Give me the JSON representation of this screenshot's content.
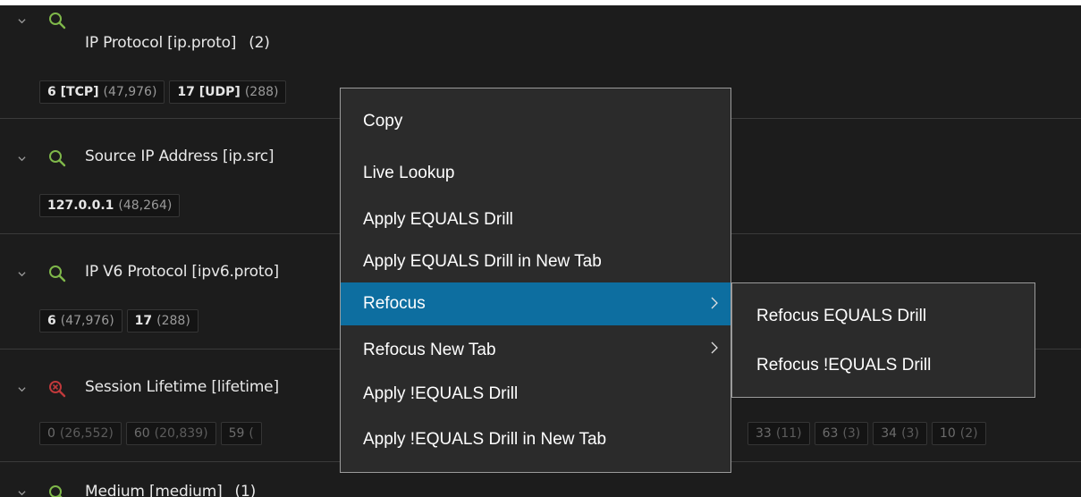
{
  "sections": [
    {
      "title": "IP Protocol [ip.proto]",
      "count": "(2)",
      "icon": "magnifier-icon",
      "icon_color": "#7fb84a",
      "chips": [
        {
          "value": "6 [TCP]",
          "count": "(47,976)"
        },
        {
          "value": "17 [UDP]",
          "count": "(288)"
        }
      ]
    },
    {
      "title": "Source IP Address [ip.src]",
      "count": "",
      "icon": "magnifier-icon",
      "icon_color": "#7fb84a",
      "chips": [
        {
          "value": "127.0.0.1",
          "count": "(48,264)"
        }
      ]
    },
    {
      "title": "IP V6 Protocol [ipv6.proto]",
      "count": "",
      "icon": "magnifier-icon",
      "icon_color": "#7fb84a",
      "chips": [
        {
          "value": "6",
          "count": "(47,976)"
        },
        {
          "value": "17",
          "count": "(288)"
        }
      ]
    },
    {
      "title": "Session Lifetime [lifetime]",
      "count": "",
      "icon": "magnifier-x-icon",
      "icon_color": "#c0393b",
      "chips_left": [
        {
          "value": "0",
          "count": "(26,552)"
        },
        {
          "value": "60",
          "count": "(20,839)"
        },
        {
          "value": "59",
          "count": "("
        }
      ],
      "chips_right": [
        {
          "value": "33",
          "count": "(11)"
        },
        {
          "value": "63",
          "count": "(3)"
        },
        {
          "value": "34",
          "count": "(3)"
        },
        {
          "value": "10",
          "count": "(2)"
        }
      ]
    },
    {
      "title": "Medium [medium]",
      "count": "(1)",
      "icon": "magnifier-icon",
      "icon_color": "#7fb84a"
    }
  ],
  "context_menu": {
    "items": [
      {
        "label": "Copy"
      },
      {
        "label": "Live Lookup"
      },
      {
        "label": "Apply EQUALS Drill"
      },
      {
        "label": "Apply EQUALS Drill in New Tab"
      },
      {
        "label": "Refocus",
        "submenu": true,
        "active": true
      },
      {
        "label": "Refocus New Tab",
        "submenu": true
      },
      {
        "label": "Apply !EQUALS Drill"
      },
      {
        "label": "Apply !EQUALS Drill in New Tab"
      }
    ],
    "active_color": "#0d6ea0"
  },
  "submenu": {
    "items": [
      {
        "label": "Refocus EQUALS Drill"
      },
      {
        "label": "Refocus !EQUALS Drill"
      }
    ]
  }
}
